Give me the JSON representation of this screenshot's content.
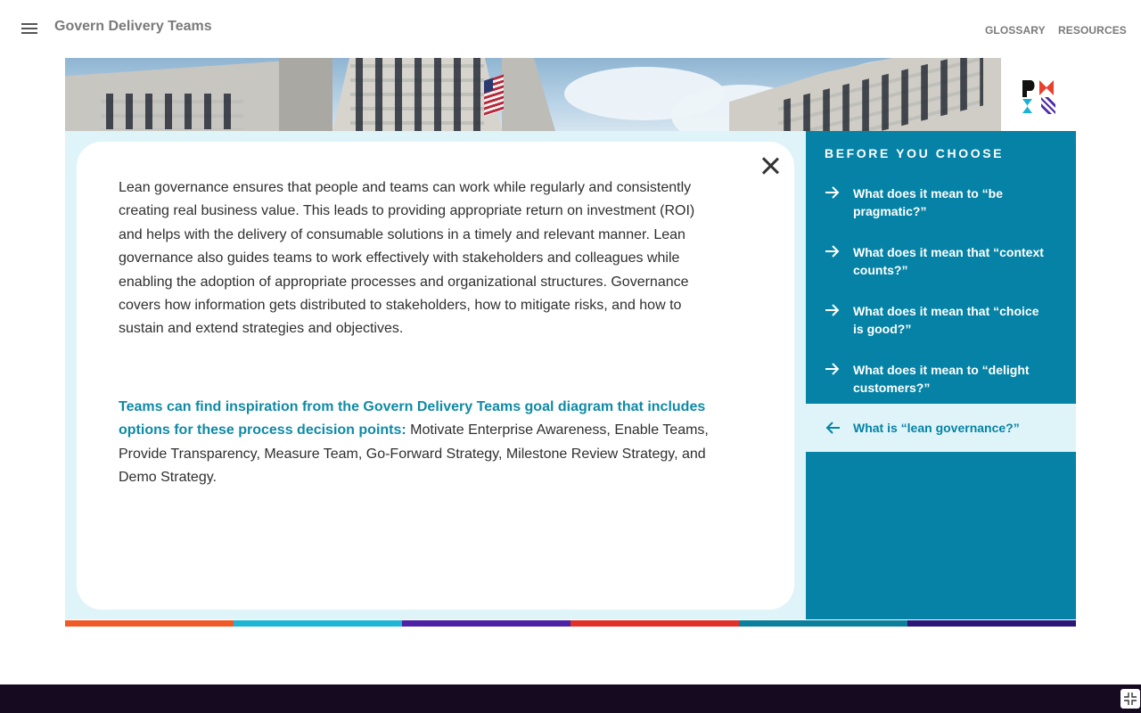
{
  "header": {
    "title": "Govern Delivery Teams",
    "nav": {
      "glossary": "GLOSSARY",
      "resources": "RESOURCES"
    }
  },
  "main": {
    "paragraph": "Lean governance ensures that people and teams can work while regularly and consistently creating real business value. This leads to providing appropriate return on investment (ROI) and helps with the delivery of consumable solutions in a timely and relevant manner. Lean governance also guides teams to work effectively with stakeholders and colleagues while enabling the adoption of appropriate processes and organizational structures. Governance covers how information gets distributed to stakeholders, how to mitigate risks, and how to sustain and extend strategies and objectives.",
    "callout_highlight": "Teams can find inspiration from the Govern Delivery Teams goal diagram that includes options for these process decision points:",
    "callout_text": " Motivate Enterprise Awareness, Enable Teams, Provide Transparency, Measure Team, Go-Forward Strategy, Milestone Review Strategy, and Demo Strategy."
  },
  "sidebar": {
    "title": "BEFORE YOU CHOOSE",
    "items": [
      {
        "label": "What does it mean to “be pragmatic?”",
        "active": false
      },
      {
        "label": "What does it mean that “context counts?”",
        "active": false
      },
      {
        "label": "What does it mean that “choice is good?”",
        "active": false
      },
      {
        "label": "What does it mean to “delight customers?”",
        "active": false
      },
      {
        "label": "What is “lean governance?”",
        "active": true
      }
    ]
  },
  "icons": {
    "menu": "hamburger-menu-icon",
    "close": "close-icon",
    "arrow_forward": "arrow-right-icon",
    "arrow_back": "arrow-left-icon",
    "fullscreen": "exit-fullscreen-icon",
    "logo": "pmi-logo"
  },
  "colors": {
    "accent": "#0582a5",
    "highlight_text": "#0f8aa6",
    "panel_bg": "#dff4f8",
    "footer": "#160a20",
    "stripes": [
      "#f05a28",
      "#1fb6d6",
      "#4d22a6",
      "#e0322b",
      "#0c7f9c",
      "#2c1779"
    ]
  }
}
